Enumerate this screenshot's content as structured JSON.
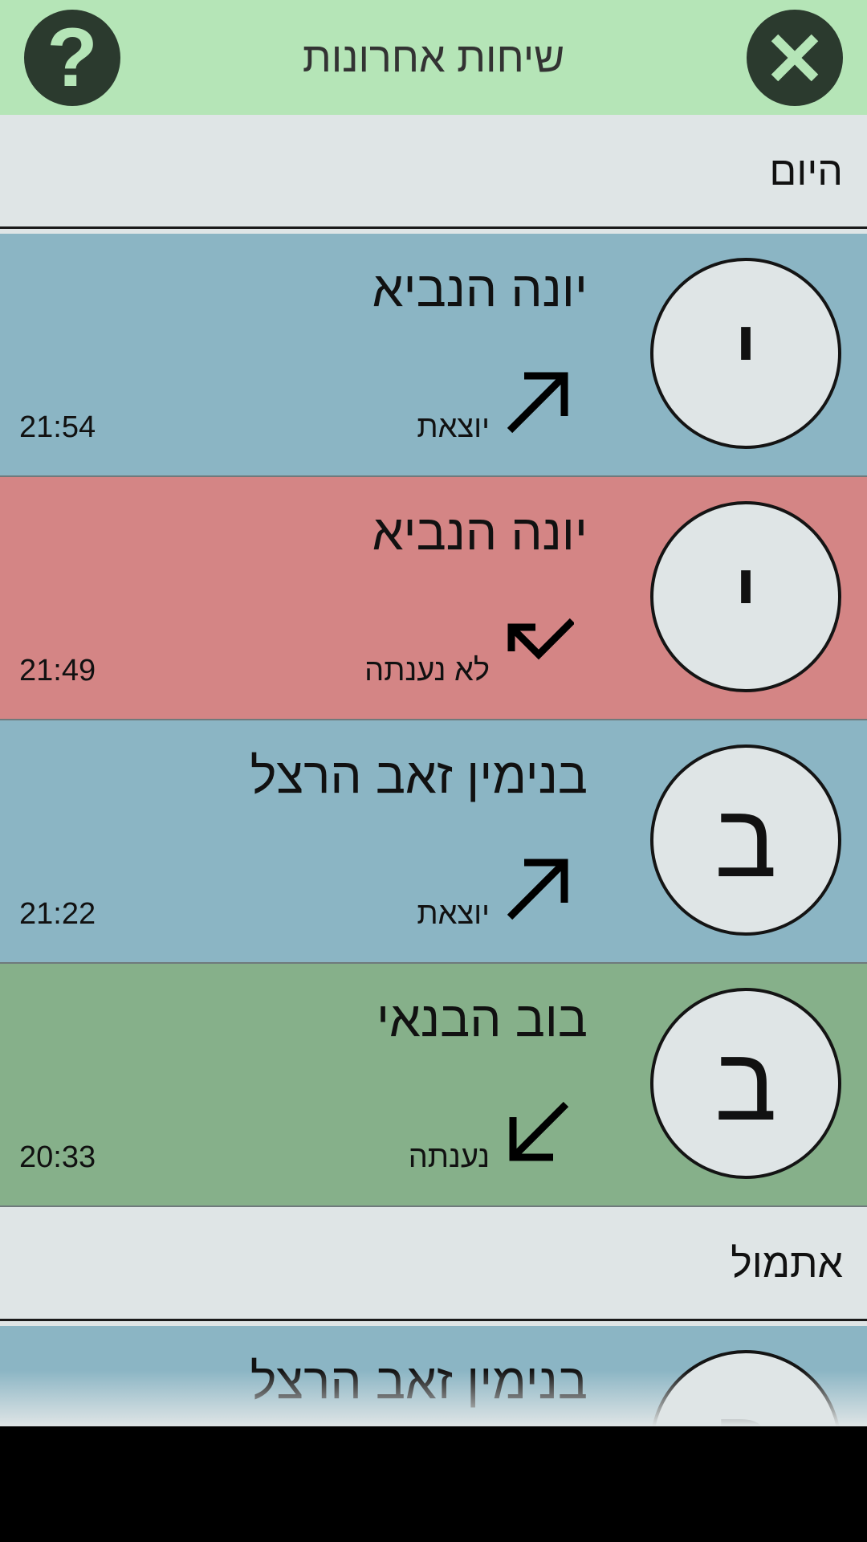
{
  "header": {
    "title": "שיחות אחרונות",
    "help_symbol": "?",
    "help_icon": "question-icon",
    "close_icon": "close-icon",
    "background": "#b5e5b7",
    "button_color": "#2b3a2e"
  },
  "sections": [
    {
      "label": "היום",
      "calls": [
        {
          "initial": "י",
          "name": "יונה הנביא",
          "direction": "יוצאת",
          "icon": "outgoing-call-icon",
          "time": "21:54",
          "color": "#8bb5c4"
        },
        {
          "initial": "י",
          "name": "יונה הנביא",
          "direction": "לא נענתה",
          "icon": "missed-call-icon",
          "time": "21:49",
          "color": "#d48585"
        },
        {
          "initial": "ב",
          "name": "בנימין זאב הרצל",
          "direction": "יוצאת",
          "icon": "outgoing-call-icon",
          "time": "21:22",
          "color": "#8bb5c4"
        },
        {
          "initial": "ב",
          "name": "בוב הבנאי",
          "direction": "נענתה",
          "icon": "incoming-call-icon",
          "time": "20:33",
          "color": "#86b08a"
        }
      ]
    },
    {
      "label": "אתמול",
      "calls": [
        {
          "initial": "ב",
          "name": "בנימין זאב הרצל",
          "color": "#8bb5c4"
        }
      ]
    }
  ]
}
